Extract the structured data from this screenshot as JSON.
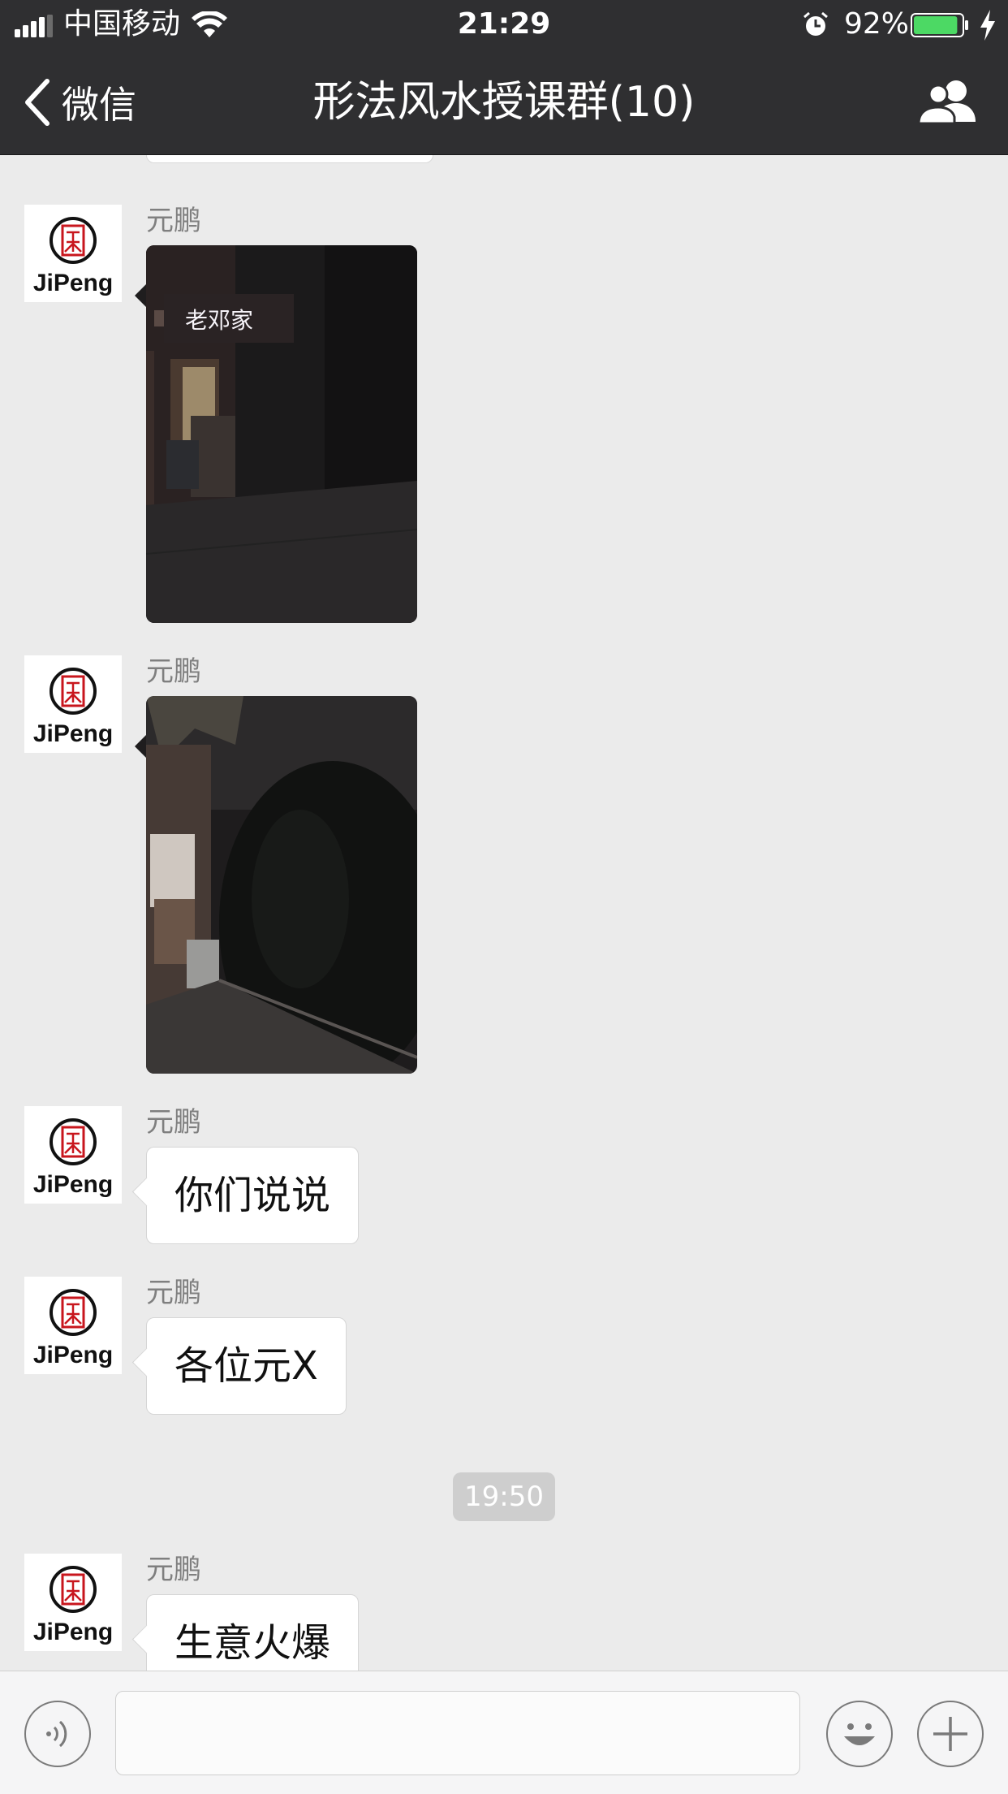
{
  "status_bar": {
    "carrier": "中国移动",
    "time": "21:29",
    "battery_percent": "92%",
    "battery_level": 0.92,
    "signal_bars": 4,
    "signal_bars_total": 5
  },
  "nav": {
    "back_label": "微信",
    "title": "形法风水授课群(10)",
    "back_icon": "chevron-left-icon",
    "right_icon": "group-members-icon"
  },
  "messages": [
    {
      "sender": "元鹏",
      "type": "image",
      "avatar_text": "JiPeng",
      "image_sign": "老邓家"
    },
    {
      "sender": "元鹏",
      "type": "image",
      "avatar_text": "JiPeng"
    },
    {
      "sender": "元鹏",
      "type": "text",
      "text": "你们说说",
      "avatar_text": "JiPeng"
    },
    {
      "sender": "元鹏",
      "type": "text",
      "text": "各位元X",
      "avatar_text": "JiPeng"
    },
    {
      "type": "timestamp",
      "text": "19:50"
    },
    {
      "sender": "元鹏",
      "type": "text",
      "text": "生意火爆",
      "avatar_text": "JiPeng"
    }
  ],
  "input_bar": {
    "voice_icon": "voice-icon",
    "emoji_icon": "emoji-icon",
    "more_icon": "plus-icon",
    "text_value": ""
  },
  "colors": {
    "bar_background": "#2f2f31",
    "chat_background": "#ebebeb",
    "battery_green": "#4cd964",
    "avatar_red": "#c8161d"
  }
}
